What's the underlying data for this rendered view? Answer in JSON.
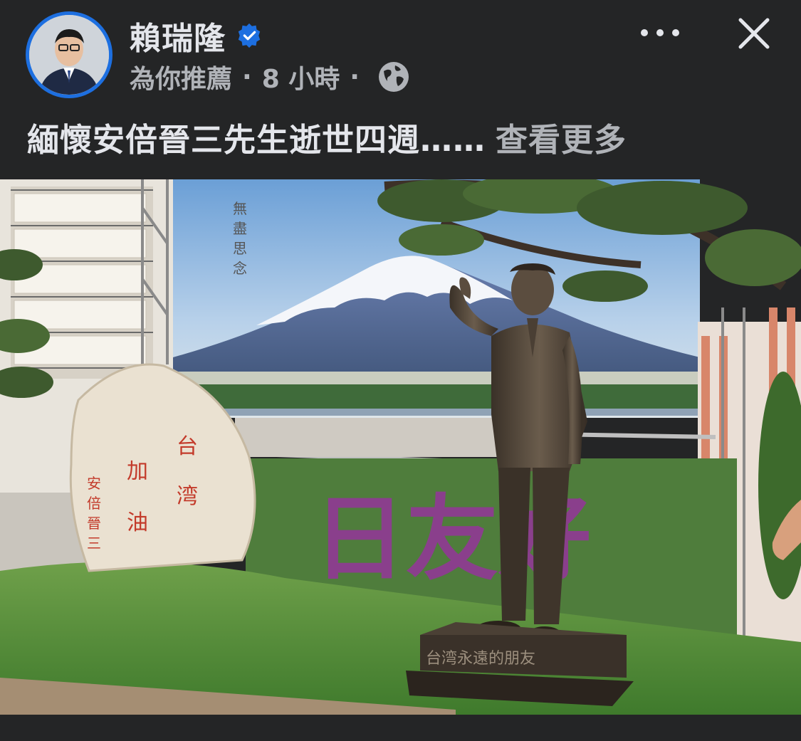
{
  "post": {
    "author": "賴瑞隆",
    "recommendation": "為你推薦",
    "separator": "·",
    "time": "8 小時",
    "text": "緬懷安倍晉三先生逝世四週……",
    "see_more": "查看更多"
  },
  "photo": {
    "calligraphy": "無盡思念",
    "rock_inscription_left": "安倍晉三",
    "rock_inscription_mid": "加油",
    "rock_inscription_right": "台湾",
    "hedge_text": "日友好",
    "plaque": "台湾永遠的朋友"
  },
  "icons": {
    "verified": "verified-badge-icon",
    "privacy": "globe-icon",
    "more": "more-options-icon",
    "close": "close-icon"
  },
  "colors": {
    "background": "#242526",
    "primary_text": "#e4e6eb",
    "secondary_text": "#b0b3b8",
    "verified_blue": "#1d6fe0"
  }
}
